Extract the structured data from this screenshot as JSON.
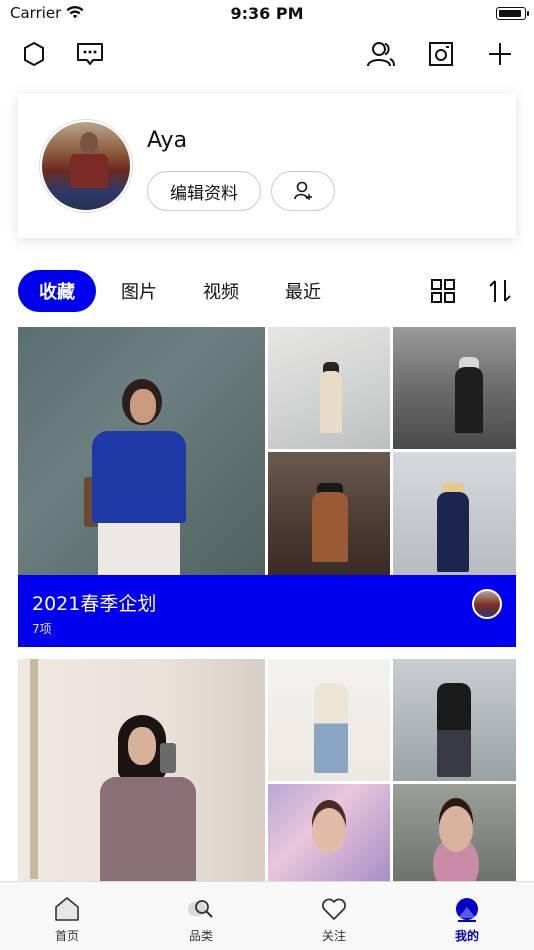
{
  "status_bar": {
    "carrier": "Carrier",
    "time": "9:36 PM",
    "battery_level": 0.95
  },
  "toolbar": {
    "left_icons": [
      "settings-icon",
      "message-icon"
    ],
    "right_icons": [
      "friends-icon",
      "camera-icon",
      "add-icon"
    ]
  },
  "profile": {
    "name": "Aya",
    "edit_button": "编辑资料",
    "invite_icon": "add-user-icon"
  },
  "tabs": [
    {
      "label": "收藏",
      "active": true
    },
    {
      "label": "图片",
      "active": false
    },
    {
      "label": "视频",
      "active": false
    },
    {
      "label": "最近",
      "active": false
    }
  ],
  "view_icons": [
    "grid-view-icon",
    "sort-icon"
  ],
  "collections": [
    {
      "title": "2021春季企划",
      "count": "7项",
      "accent": "#0000ee"
    },
    {
      "title": "",
      "count": ""
    }
  ],
  "tabbar": [
    {
      "label": "首页",
      "icon": "home-icon",
      "active": false
    },
    {
      "label": "品类",
      "icon": "category-search-icon",
      "active": false
    },
    {
      "label": "关注",
      "icon": "heart-icon",
      "active": false
    },
    {
      "label": "我的",
      "icon": "profile-icon",
      "active": true
    }
  ],
  "colors": {
    "accent": "#0000ee",
    "tabbar_active": "#0000cc"
  }
}
